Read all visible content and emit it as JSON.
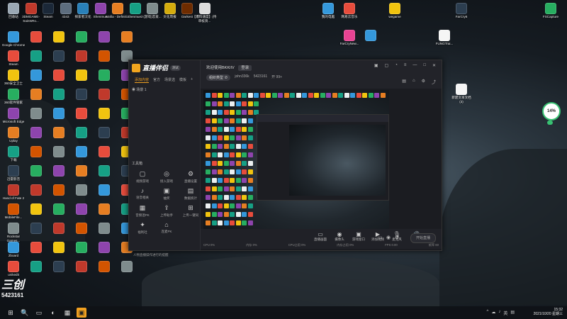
{
  "desktop_icons_left": [
    {
      "label": "回收站",
      "color": "#9aa7b3"
    },
    {
      "label": "3DMGAME-\nSaintsRo...",
      "color": "#c0392b"
    },
    {
      "label": "Steam",
      "color": "#1b2838"
    },
    {
      "label": "4343",
      "color": "#5d6d7e"
    },
    {
      "label": "探索者汉化",
      "color": "#2980b9"
    },
    {
      "label": "Shenmue",
      "color": "#8e44ad"
    },
    {
      "label": "Mafia - Definiti...",
      "color": "#e67e22"
    },
    {
      "label": "Shenmue2",
      "color": "#16a085"
    },
    {
      "label": "(游戏)恋爱...",
      "color": "#7f8c8d"
    },
    {
      "label": "文化周报",
      "color": "#d4ac0d"
    },
    {
      "label": "Darkest",
      "color": "#6e2c00"
    },
    {
      "label": "【爆料速度】(待审核资...",
      "color": "#dcdcdc"
    }
  ],
  "desktop_icons_right": [
    {
      "label": "我的电脑",
      "color": "#3498db"
    },
    {
      "label": "网易云音乐",
      "color": "#e74c3c"
    },
    {
      "label": "wegame",
      "color": "#f1c40f"
    },
    {
      "label": "FarCry6",
      "color": "#2c3e50"
    },
    {
      "label": "FSCapture",
      "color": "#27ae60"
    },
    {
      "label": "FarCryNew...",
      "color": "#e84393"
    },
    {
      "label": "",
      "color": "#3498db"
    },
    {
      "label": "FUNGTrai...",
      "color": "#f5f5f5"
    },
    {
      "label": "新建文本文档 (3)",
      "color": "#f5f5f5"
    }
  ],
  "column_labels": [
    "Google Chrome",
    "Steam",
    "360安全卫士",
    "360软件管家",
    "Microsoft Edge",
    "Uplay",
    "下载",
    "迅雷影音",
    "Hand of Fate 2",
    "MobileFile...",
    "Rockstar Games...",
    "2board",
    "unikedit"
  ],
  "app": {
    "brand": "直播伴侣",
    "version": "测试",
    "left_tabs": [
      "添加内容",
      "官方",
      "场景选",
      "模板"
    ],
    "scene": "场景 1",
    "tools_title": "工具箱",
    "tools": [
      {
        "label": "视频游戏",
        "icon": "▢"
      },
      {
        "label": "接入游戏",
        "icon": "◎"
      },
      {
        "label": "直播设置",
        "icon": "⚙"
      },
      {
        "label": "语音相关",
        "icon": "♪"
      },
      {
        "label": "抽奖",
        "icon": "▣"
      },
      {
        "label": "数据统计",
        "icon": "▤"
      },
      {
        "label": "音频混PK",
        "icon": "▦"
      },
      {
        "label": "上传助手",
        "icon": "⇪"
      },
      {
        "label": "上传一键同",
        "icon": "⊞"
      },
      {
        "label": "福利社",
        "icon": "✦"
      },
      {
        "label": "连麦PK",
        "icon": "⌂"
      }
    ],
    "tip": "人物直播操作进行的提醒",
    "welcome": "欢迎使用BKKIIV",
    "welcome_btn": "登录",
    "meta_pill": "组织类型 ⊘",
    "meta_user": "john336k",
    "meta_id": "5423161",
    "meta_status": "开 99+",
    "bottom_controls": [
      {
        "label": "直播画面",
        "icon": "▭"
      },
      {
        "label": "摄像头",
        "icon": "◉"
      },
      {
        "label": "游戏窗口",
        "icon": "▣"
      },
      {
        "label": "添加视频",
        "icon": "▶"
      },
      {
        "label": "麦克风",
        "icon": "🎙"
      },
      {
        "label": "扬声器",
        "icon": "🔊"
      }
    ],
    "go_live": "开始直播",
    "stats": [
      "CPU 0%",
      "内存 0%",
      "CPU占用 0%",
      "内存占用 0%",
      "FPS 0.00",
      "帧率 60"
    ]
  },
  "watermark": {
    "brand": "三创",
    "id": "5423161"
  },
  "tray": {
    "time": "15:32",
    "date": "2021/10/20 星期三",
    "icons": [
      "^",
      "☁",
      "♪",
      "英",
      "▤"
    ]
  },
  "net_badge": "14%",
  "taskbar": {
    "items": [
      "⊞",
      "🔍",
      "▭",
      "◐",
      "▦",
      "▣"
    ]
  }
}
